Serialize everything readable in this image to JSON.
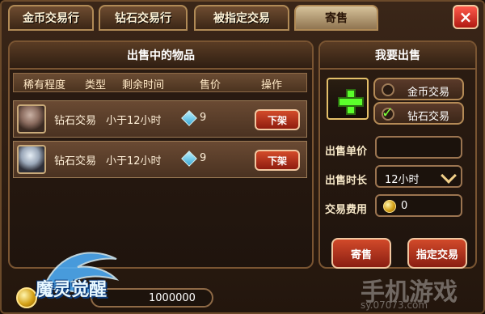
{
  "tabs": [
    {
      "label": "金币交易行",
      "active": false
    },
    {
      "label": "钻石交易行",
      "active": false
    },
    {
      "label": "被指定交易",
      "active": false
    },
    {
      "label": "寄售",
      "active": true
    }
  ],
  "close_icon": "×",
  "left_panel": {
    "title": "出售中的物品",
    "columns": [
      "稀有程度",
      "类型",
      "剩余时间",
      "售价",
      "操作"
    ],
    "rows": [
      {
        "type": "钻石交易",
        "time_left": "小于12小时",
        "price": "9",
        "action": "下架"
      },
      {
        "type": "钻石交易",
        "time_left": "小于12小时",
        "price": "9",
        "action": "下架"
      }
    ]
  },
  "right_panel": {
    "title": "我要出售",
    "options": [
      {
        "label": "金币交易",
        "selected": false
      },
      {
        "label": "钻石交易",
        "selected": true
      }
    ],
    "unit_price_label": "出售单价",
    "unit_price_value": "",
    "duration_label": "出售时长",
    "duration_value": "12小时",
    "fee_label": "交易费用",
    "fee_value": "0",
    "buttons": {
      "consign": "寄售",
      "designate": "指定交易"
    }
  },
  "footer": {
    "game_logo_text": "魔灵觉醒",
    "money_value": "1000000",
    "watermark_main": "手机游戏",
    "watermark_sub": "sy.07073.com"
  },
  "colors": {
    "accent_green": "#5bff2b",
    "accent_red": "#b01a12",
    "gold": "#d5a218"
  }
}
